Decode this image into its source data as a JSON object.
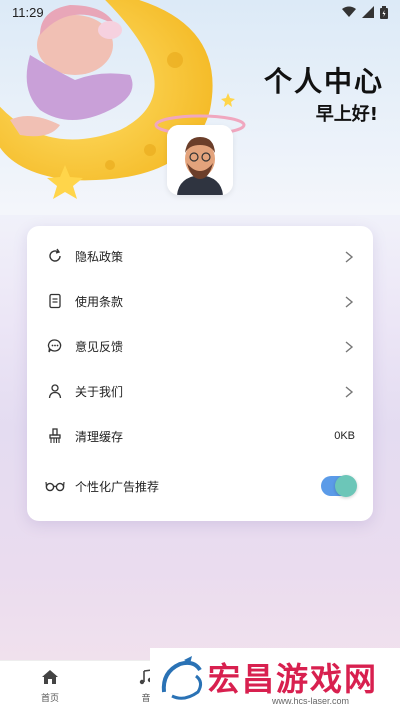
{
  "status": {
    "time": "11:29"
  },
  "header": {
    "title": "个人中心",
    "greeting": "早上好!"
  },
  "menu": [
    {
      "icon": "refresh-icon",
      "label": "隐私政策",
      "trailing": "chevron"
    },
    {
      "icon": "document-icon",
      "label": "使用条款",
      "trailing": "chevron"
    },
    {
      "icon": "chat-bubble-icon",
      "label": "意见反馈",
      "trailing": "chevron"
    },
    {
      "icon": "person-icon",
      "label": "关于我们",
      "trailing": "chevron"
    },
    {
      "icon": "brush-icon",
      "label": "清理缓存",
      "trailing": "value",
      "value": "0KB"
    },
    {
      "icon": "glasses-icon",
      "label": "个性化广告推荐",
      "trailing": "toggle",
      "toggle_on": true
    }
  ],
  "tabs": [
    {
      "icon": "home-icon",
      "label": "首页"
    },
    {
      "icon": "music-note-icon",
      "label": "音"
    }
  ],
  "watermark": {
    "text": "宏昌游戏网",
    "url": "www.hcs-laser.com"
  },
  "colors": {
    "toggle_track": "#5b9be8",
    "toggle_knob": "#6cc6b8",
    "watermark": "#d8204f"
  }
}
